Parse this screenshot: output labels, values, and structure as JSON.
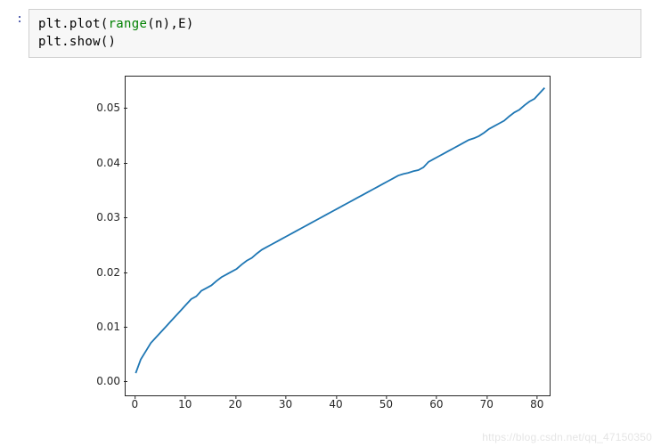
{
  "cell": {
    "prompt": ":",
    "code_line1_a": "plt.plot(",
    "code_line1_b": "range",
    "code_line1_c": "(n),E)",
    "code_line2": "plt.show()"
  },
  "watermark": "https://blog.csdn.net/qq_47150350",
  "chart_data": {
    "type": "line",
    "title": "",
    "xlabel": "",
    "ylabel": "",
    "xlim": [
      -2,
      82
    ],
    "ylim": [
      -0.002,
      0.056
    ],
    "x_ticks": [
      0,
      10,
      20,
      30,
      40,
      50,
      60,
      70,
      80
    ],
    "y_ticks": [
      0.0,
      0.01,
      0.02,
      0.03,
      0.04,
      0.05
    ],
    "y_tick_labels": [
      "0.00",
      "0.01",
      "0.02",
      "0.03",
      "0.04",
      "0.05"
    ],
    "series": [
      {
        "name": "E",
        "color": "#1f77b4",
        "x": [
          0,
          1,
          2,
          3,
          4,
          5,
          6,
          7,
          8,
          9,
          10,
          11,
          12,
          13,
          14,
          15,
          16,
          17,
          18,
          19,
          20,
          21,
          22,
          23,
          24,
          25,
          26,
          27,
          28,
          29,
          30,
          31,
          32,
          33,
          34,
          35,
          36,
          37,
          38,
          39,
          40,
          41,
          42,
          43,
          44,
          45,
          46,
          47,
          48,
          49,
          50,
          51,
          52,
          53,
          54,
          55,
          56,
          57,
          58,
          59,
          60,
          61,
          62,
          63,
          64,
          65,
          66,
          67,
          68,
          69,
          70,
          71,
          72,
          73,
          74,
          75,
          76,
          77,
          78,
          79,
          80,
          81
        ],
        "y": [
          0.002,
          0.0045,
          0.006,
          0.0075,
          0.0085,
          0.0095,
          0.0105,
          0.0115,
          0.0125,
          0.0135,
          0.0145,
          0.0155,
          0.016,
          0.017,
          0.0175,
          0.018,
          0.0188,
          0.0195,
          0.02,
          0.0205,
          0.021,
          0.0218,
          0.0225,
          0.023,
          0.0238,
          0.0245,
          0.025,
          0.0255,
          0.026,
          0.0265,
          0.027,
          0.0275,
          0.028,
          0.0285,
          0.029,
          0.0295,
          0.03,
          0.0305,
          0.031,
          0.0315,
          0.032,
          0.0325,
          0.033,
          0.0335,
          0.034,
          0.0345,
          0.035,
          0.0355,
          0.036,
          0.0365,
          0.037,
          0.0375,
          0.038,
          0.0383,
          0.0385,
          0.0388,
          0.039,
          0.0395,
          0.0405,
          0.041,
          0.0415,
          0.042,
          0.0425,
          0.043,
          0.0435,
          0.044,
          0.0445,
          0.0448,
          0.0452,
          0.0458,
          0.0465,
          0.047,
          0.0475,
          0.048,
          0.0488,
          0.0495,
          0.05,
          0.0508,
          0.0515,
          0.052,
          0.053,
          0.054
        ]
      }
    ]
  }
}
